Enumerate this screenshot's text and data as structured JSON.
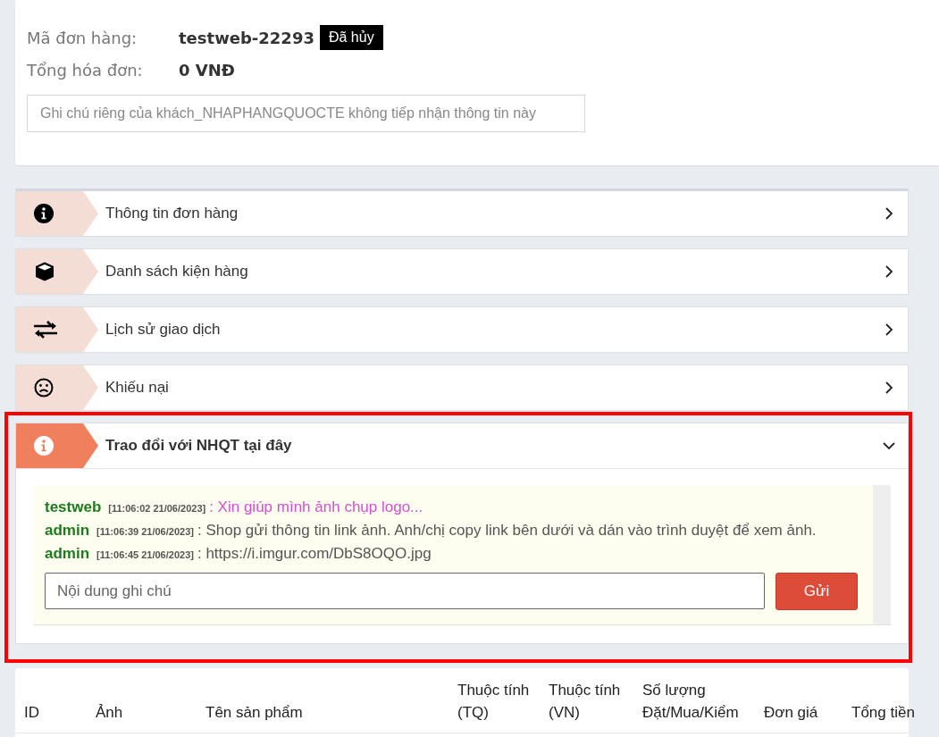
{
  "order": {
    "code_label": "Mã đơn hàng:",
    "code": "testweb-22293",
    "status": "Đã hủy",
    "total_label": "Tổng hóa đơn:",
    "total": "0 VNĐ",
    "note_placeholder": "Ghi chú riêng của khách_NHAPHANGQUOCTE không tiếp nhận thông tin này"
  },
  "sections": [
    {
      "title": "Thông tin đơn hàng",
      "expanded": false
    },
    {
      "title": "Danh sách kiện hàng",
      "expanded": false
    },
    {
      "title": "Lịch sử giao dịch",
      "expanded": false
    },
    {
      "title": "Khiếu nại",
      "expanded": false
    },
    {
      "title": "Trao đổi với NHQT tại đây",
      "expanded": true
    }
  ],
  "chat": {
    "messages": [
      {
        "user": "testweb",
        "time": "[11:06:02 21/06/2023]",
        "text": ": Xin giúp mình ảnh chụp logo...",
        "color": "#d54fd5"
      },
      {
        "user": "admin",
        "time": "[11:06:39 21/06/2023]",
        "text": ": Shop gửi thông tin link ảnh. Anh/chị copy link bên dưới và dán vào trình duyệt để xem ảnh.",
        "color": "#555555"
      },
      {
        "user": "admin",
        "time": "[11:06:45 21/06/2023]",
        "text": ": https://i.imgur.com/DbS8OQO.jpg",
        "color": "#555555"
      }
    ],
    "input_placeholder": "Nội dung ghi chú",
    "send": "Gửi"
  },
  "table": {
    "columns": [
      "ID",
      "Ảnh",
      "Tên sản phẩm",
      "Thuộc tính (TQ)",
      "Thuộc tính (VN)",
      "Số lượng Đặt/Mua/Kiểm",
      "Đơn giá",
      "Tổng tiền"
    ]
  }
}
